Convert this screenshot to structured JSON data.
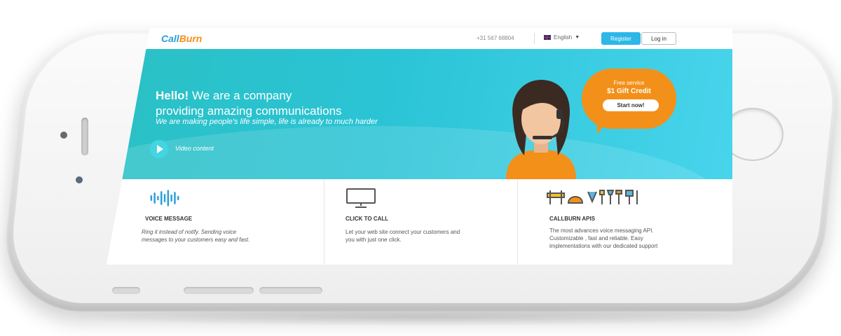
{
  "nav": {
    "logo_part1": "Call",
    "logo_part2": "Burn",
    "phone": "+31 567 68804",
    "language": "English",
    "register_label": "Register",
    "login_label": "Log in"
  },
  "hero": {
    "title_bold": "Hello!",
    "title_rest": " We are a company",
    "title_line2": "providing amazing communications",
    "subtitle": "We are making people's life simple, life is already to much harder",
    "video_label": "Video content"
  },
  "promo": {
    "line1": "Free service",
    "line2": "$1 Gift Credit",
    "button_label": "Start now!"
  },
  "features": [
    {
      "icon": "sound-wave-icon",
      "title": "VOICE MESSAGE",
      "description_line1": "Ring it instead of notify. Sending voice",
      "description_line2": "messages to your customers easy and fast."
    },
    {
      "icon": "monitor-icon",
      "title": "CLICK TO CALL",
      "description_line1": "Let your web site connect your customers and",
      "description_line2": "you with just one click."
    },
    {
      "icon": "tools-icon",
      "title": "CALLBURN APIS",
      "description_line1": "The most advances voice messaging API.",
      "description_line2": "Customizable , fast and reliable. Easy",
      "description_line3": "implementations with our dedicated support"
    }
  ],
  "colors": {
    "accent": "#2cb7e8",
    "hero_teal": "#2bc4d6",
    "promo_orange": "#f39019"
  }
}
